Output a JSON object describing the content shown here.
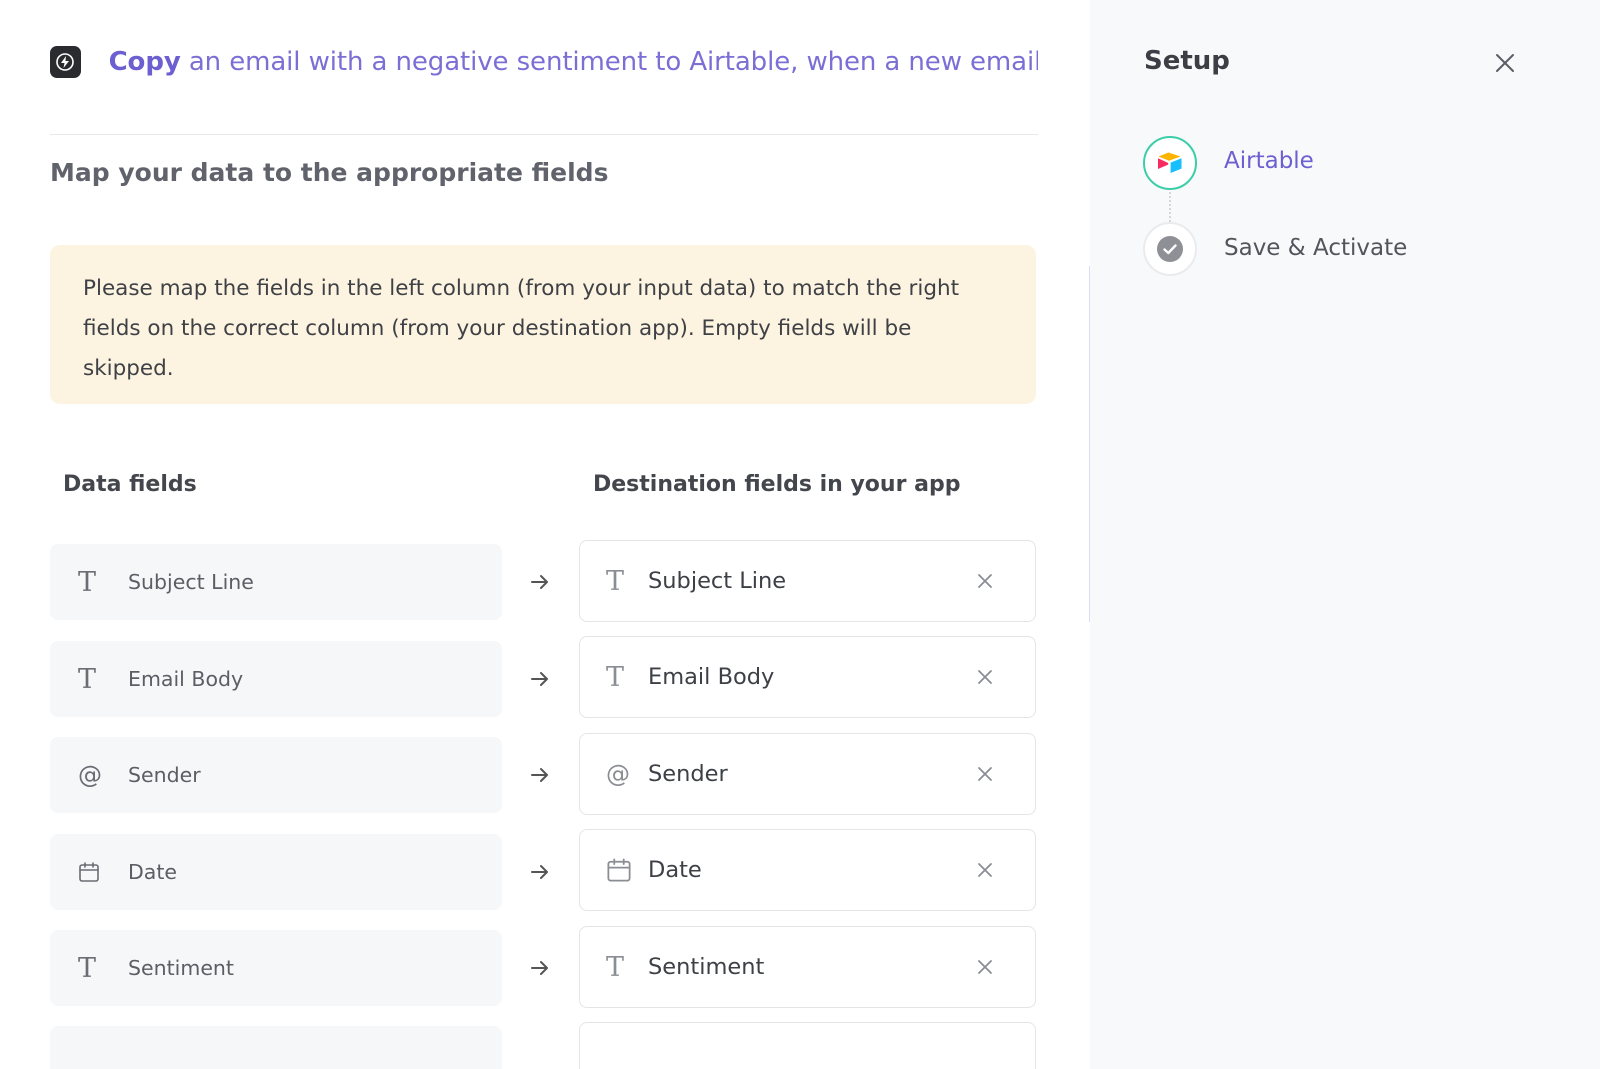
{
  "header": {
    "title_bold": "Copy",
    "title_rest": " an email with a negative sentiment to Airtable, when a new email i..."
  },
  "mapping": {
    "subtitle": "Map your data to the appropriate fields",
    "notice": "Please map the fields in the left column (from your input data) to match the right fields on the correct column (from your destination app). Empty fields will be skipped.",
    "left_header": "Data fields",
    "right_header": "Destination fields in your app",
    "rows": [
      {
        "source": "Subject Line",
        "destination": "Subject Line",
        "icon": "text-icon"
      },
      {
        "source": "Email Body",
        "destination": "Email Body",
        "icon": "text-icon"
      },
      {
        "source": "Sender",
        "destination": "Sender",
        "icon": "at-icon"
      },
      {
        "source": "Date",
        "destination": "Date",
        "icon": "calendar-icon"
      },
      {
        "source": "Sentiment",
        "destination": "Sentiment",
        "icon": "text-icon"
      }
    ]
  },
  "setup": {
    "title": "Setup",
    "steps": [
      {
        "label": "Airtable",
        "state": "active",
        "icon": "airtable-logo-icon"
      },
      {
        "label": "Save & Activate",
        "state": "pending",
        "icon": "check-circle-icon"
      }
    ]
  },
  "colors": {
    "accent": "#6c5fd1",
    "notice_bg": "#fcf4e0",
    "step_active_ring": "#3ccda9",
    "sidebar_bg": "#f8f9fa"
  }
}
